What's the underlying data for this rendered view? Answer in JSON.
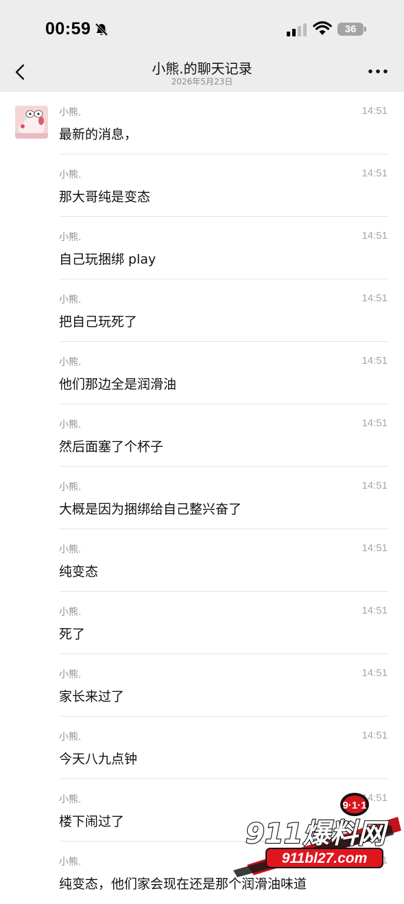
{
  "status_bar": {
    "time": "00:59",
    "battery": "36"
  },
  "header": {
    "title": "小熊.的聊天记录",
    "date": "2026年5月23日"
  },
  "messages": [
    {
      "sender": "小熊.",
      "time": "14:51",
      "text": "最新的消息，"
    },
    {
      "sender": "小熊.",
      "time": "14:51",
      "text": "那大哥纯是变态"
    },
    {
      "sender": "小熊.",
      "time": "14:51",
      "text": "自己玩捆绑 play"
    },
    {
      "sender": "小熊.",
      "time": "14:51",
      "text": "把自己玩死了"
    },
    {
      "sender": "小熊.",
      "time": "14:51",
      "text": "他们那边全是润滑油"
    },
    {
      "sender": "小熊.",
      "time": "14:51",
      "text": "然后面塞了个杯子"
    },
    {
      "sender": "小熊.",
      "time": "14:51",
      "text": "大概是因为捆绑给自己整兴奋了"
    },
    {
      "sender": "小熊.",
      "time": "14:51",
      "text": "纯变态"
    },
    {
      "sender": "小熊.",
      "time": "14:51",
      "text": "死了"
    },
    {
      "sender": "小熊.",
      "time": "14:51",
      "text": "家长来过了"
    },
    {
      "sender": "小熊.",
      "time": "14:51",
      "text": "今天八九点钟"
    },
    {
      "sender": "小熊.",
      "time": "14:51",
      "text": "楼下闹过了"
    },
    {
      "sender": "小熊.",
      "time": "14:51",
      "text": "纯变态，他们家会现在还是那个润滑油味道"
    }
  ],
  "watermark": {
    "badge": "9·1·1",
    "brand": "911爆料网",
    "url": "911bl27.com"
  },
  "icons": {
    "back": "chevron-left-icon",
    "more": "more-dots-icon",
    "bell": "bell-slash-icon"
  }
}
